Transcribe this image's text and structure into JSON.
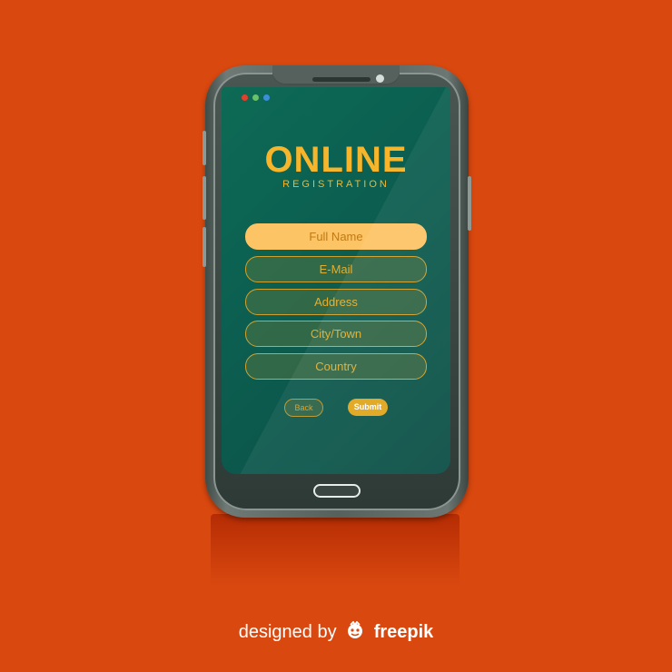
{
  "screen": {
    "title": "ONLINE",
    "subtitle": "REGISTRATION",
    "fields": [
      {
        "label": "Full Name"
      },
      {
        "label": "E-Mail"
      },
      {
        "label": "Address"
      },
      {
        "label": "City/Town"
      },
      {
        "label": "Country"
      }
    ],
    "back_label": "Back",
    "submit_label": "Submit"
  },
  "credit": {
    "prefix": "designed by",
    "brand": "freepik"
  },
  "colors": {
    "background": "#d9480f",
    "accent": "#f6b52a",
    "screen": "#0c5e50"
  },
  "icons": [
    "window-dots-icon",
    "freepik-logo-icon"
  ]
}
